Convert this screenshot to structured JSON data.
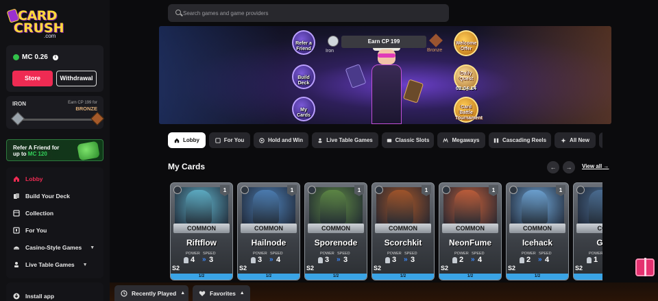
{
  "brand": {
    "line1": "CARD",
    "line2": "CRUSH",
    "suffix": ".com"
  },
  "wallet": {
    "balance": "MC 0.26",
    "store": "Store",
    "withdrawal": "Withdrawal"
  },
  "rank": {
    "current": "IRON",
    "earn_text": "Earn CP 199 for",
    "next": "BRONZE",
    "progress": 0
  },
  "referral": {
    "line1": "Refer A Friend for",
    "line2_prefix": "up to",
    "line2_amount": "MC 120"
  },
  "nav": {
    "items": [
      {
        "label": "Lobby",
        "icon": "home-icon",
        "active": true
      },
      {
        "label": "Build Your Deck",
        "icon": "cards-icon"
      },
      {
        "label": "Collection",
        "icon": "collection-icon"
      },
      {
        "label": "For You",
        "icon": "bookmark-icon"
      },
      {
        "label": "Casino-Style Games",
        "icon": "casino-icon",
        "expand": true
      },
      {
        "label": "Live Table Games",
        "icon": "dealer-icon",
        "expand": true
      }
    ],
    "install": "Install app"
  },
  "search": {
    "placeholder": "Search games and game providers"
  },
  "banner": {
    "left_buttons": [
      "Refer a Friend",
      "Build Deck",
      "My Cards"
    ],
    "earn_bar": "Earn CP 199",
    "iron_label": "Iron",
    "bronze_label": "Bronze",
    "right_buttons": [
      "Welcome Offer",
      "Daily Quest",
      "Card Battle Tournament"
    ],
    "timer": "02:04:14"
  },
  "tabs": [
    {
      "label": "Lobby",
      "icon": "home-icon",
      "active": true
    },
    {
      "label": "For You",
      "icon": "bookmark-icon"
    },
    {
      "label": "Hold and Win",
      "icon": "chip-icon"
    },
    {
      "label": "Live Table Games",
      "icon": "dealer-icon"
    },
    {
      "label": "Classic Slots",
      "icon": "slots-icon"
    },
    {
      "label": "Megaways",
      "icon": "megaways-icon"
    },
    {
      "label": "Cascading Reels",
      "icon": "reels-icon"
    },
    {
      "label": "All New",
      "icon": "new-icon"
    }
  ],
  "my_cards": {
    "title": "My Cards",
    "view_all": "View all",
    "cards": [
      {
        "name": "Riftflow",
        "rarity": "COMMON",
        "level": "1",
        "power": "4",
        "speed": "3",
        "tier": "S2",
        "xp": "1/2",
        "power_label": "POWER",
        "speed_label": "SPEED",
        "art_color": "#5fb0c8"
      },
      {
        "name": "Hailnode",
        "rarity": "COMMON",
        "level": "1",
        "power": "3",
        "speed": "4",
        "tier": "S2",
        "xp": "1/2",
        "power_label": "POWER",
        "speed_label": "SPEED",
        "art_color": "#4d7fb5"
      },
      {
        "name": "Sporenode",
        "rarity": "COMMON",
        "level": "1",
        "power": "3",
        "speed": "3",
        "tier": "S2",
        "xp": "1/2",
        "power_label": "POWER",
        "speed_label": "SPEED",
        "art_color": "#5f8a45"
      },
      {
        "name": "Scorchkit",
        "rarity": "COMMON",
        "level": "1",
        "power": "3",
        "speed": "3",
        "tier": "S2",
        "xp": "1/2",
        "power_label": "POWER",
        "speed_label": "SPEED",
        "art_color": "#a5562a"
      },
      {
        "name": "NeonFume",
        "rarity": "COMMON",
        "level": "1",
        "power": "2",
        "speed": "4",
        "tier": "S2",
        "xp": "1/2",
        "power_label": "POWER",
        "speed_label": "SPEED",
        "art_color": "#c25f3a"
      },
      {
        "name": "Icehack",
        "rarity": "COMMON",
        "level": "1",
        "power": "2",
        "speed": "4",
        "tier": "S2",
        "xp": "1/2",
        "power_label": "POWER",
        "speed_label": "SPEED",
        "art_color": "#6fa5d6"
      },
      {
        "name": "Gus",
        "rarity": "COM",
        "level": "",
        "power": "1",
        "speed": "",
        "tier": "S2",
        "xp": "",
        "power_label": "POWER",
        "speed_label": "",
        "art_color": "#4c6f95"
      }
    ]
  },
  "bottom": {
    "recent": "Recently Played",
    "favorites": "Favorites"
  },
  "colors": {
    "accent": "#ef2b53",
    "bg": "#0b0b0d",
    "panel": "#1b1b20",
    "green": "#33d35a",
    "xp": "#3aa4e6"
  }
}
